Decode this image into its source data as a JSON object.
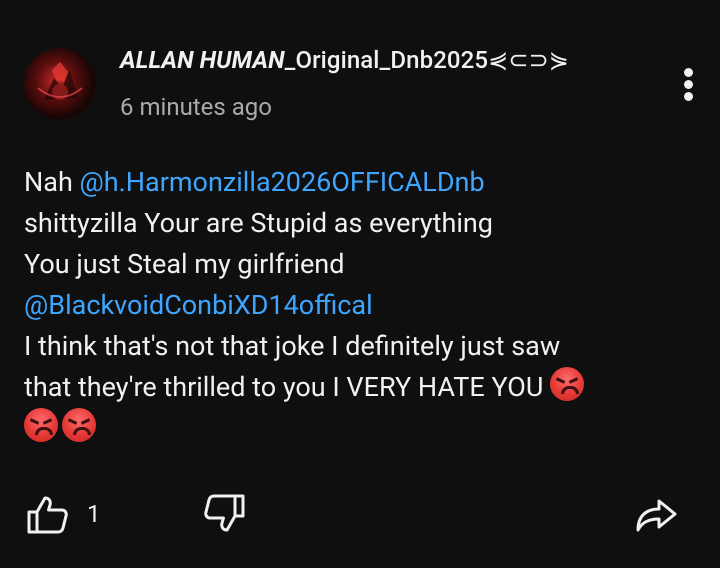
{
  "comment": {
    "author_bold": "ALLAN HUMAN",
    "author_rest": "_Original_Dnb2025⋞⊂⊃⋟",
    "time": "6 minutes ago",
    "line1_text": "Nah ",
    "mention1": "@h.Harmonzilla2026OFFICALDnb",
    "line2": "shittyzilla Your are Stupid as everything",
    "line3": "You just Steal my girlfriend",
    "mention2": "@BlackvoidConbiXD14offical",
    "line4": "I think that's not that joke I definitely just saw",
    "line5": "that they're thrilled to you I VERY HATE YOU"
  },
  "actions": {
    "like_count": "1"
  },
  "icons": {
    "avatar": "avatar-image",
    "more": "more-vertical-icon",
    "like": "thumbs-up-icon",
    "dislike": "thumbs-down-icon",
    "share": "share-icon",
    "emoji": "angry-face-emoji"
  },
  "colors": {
    "background": "#0f0f0f",
    "text": "#f1f1f1",
    "secondary_text": "#aaaaaa",
    "mention": "#3ea6ff"
  }
}
